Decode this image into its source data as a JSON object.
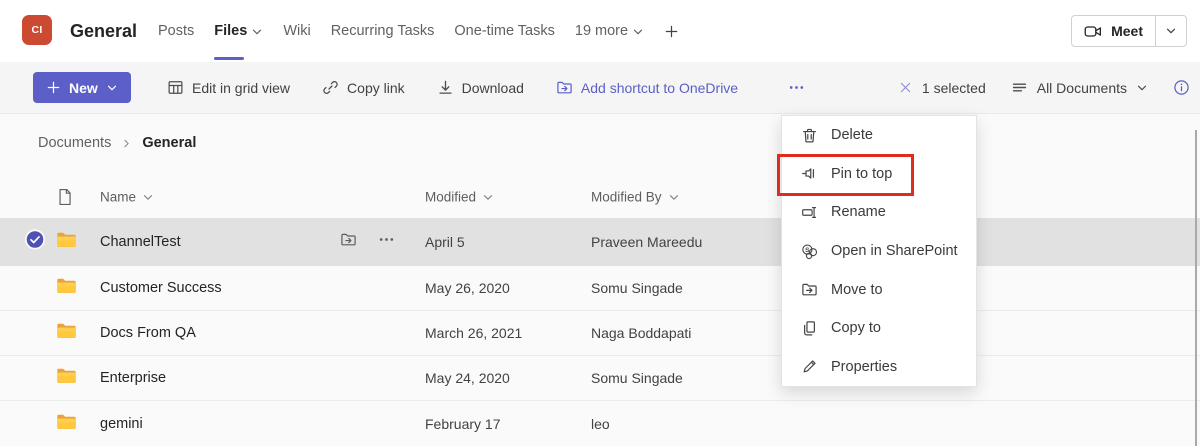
{
  "header": {
    "avatar_initials": "CI",
    "title": "General",
    "tabs": [
      {
        "label": "Posts",
        "active": false,
        "has_chevron": false
      },
      {
        "label": "Files",
        "active": true,
        "has_chevron": true
      },
      {
        "label": "Wiki",
        "active": false,
        "has_chevron": false
      },
      {
        "label": "Recurring Tasks",
        "active": false,
        "has_chevron": false
      },
      {
        "label": "One-time Tasks",
        "active": false,
        "has_chevron": false
      },
      {
        "label": "19 more",
        "active": false,
        "has_chevron": true
      }
    ],
    "meet_label": "Meet"
  },
  "toolbar": {
    "new_label": "New",
    "actions": [
      {
        "label": "Edit in grid view",
        "icon": "grid-icon",
        "accent": false
      },
      {
        "label": "Copy link",
        "icon": "link-icon",
        "accent": false
      },
      {
        "label": "Download",
        "icon": "download-icon",
        "accent": false
      },
      {
        "label": "Add shortcut to OneDrive",
        "icon": "folder-shortcut-icon",
        "accent": true
      }
    ],
    "selection_label": "1 selected",
    "view_label": "All Documents"
  },
  "breadcrumb": {
    "root": "Documents",
    "current": "General"
  },
  "table": {
    "columns": [
      "Name",
      "Modified",
      "Modified By"
    ],
    "rows": [
      {
        "name": "ChannelTest",
        "modified": "April 5",
        "modified_by": "Praveen Mareedu",
        "selected": true
      },
      {
        "name": "Customer Success",
        "modified": "May 26, 2020",
        "modified_by": "Somu Singade",
        "selected": false
      },
      {
        "name": "Docs From QA",
        "modified": "March 26, 2021",
        "modified_by": "Naga Boddapati",
        "selected": false
      },
      {
        "name": "Enterprise",
        "modified": "May 24, 2020",
        "modified_by": "Somu Singade",
        "selected": false
      },
      {
        "name": "gemini",
        "modified": "February 17",
        "modified_by": "leo",
        "selected": false
      }
    ]
  },
  "context_menu": {
    "items": [
      {
        "label": "Delete",
        "icon": "trash-icon",
        "highlighted": false
      },
      {
        "label": "Pin to top",
        "icon": "pin-icon",
        "highlighted": true
      },
      {
        "label": "Rename",
        "icon": "rename-icon",
        "highlighted": false
      },
      {
        "label": "Open in SharePoint",
        "icon": "sharepoint-icon",
        "highlighted": false
      },
      {
        "label": "Move to",
        "icon": "folder-arrow-icon",
        "highlighted": false
      },
      {
        "label": "Copy to",
        "icon": "copy-icon",
        "highlighted": false
      },
      {
        "label": "Properties",
        "icon": "pencil-icon",
        "highlighted": false
      }
    ]
  },
  "colors": {
    "accent": "#5B5FC7",
    "avatar": "#CC4A31",
    "highlight_red": "#E02B20",
    "folder_yellow": "#FFC83D",
    "selected_row": "#E1E1E1",
    "content_bg": "#FAFAFA"
  }
}
